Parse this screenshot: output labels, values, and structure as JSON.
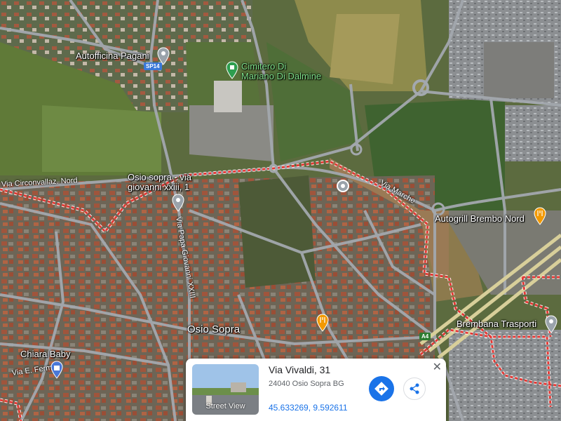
{
  "map": {
    "labels": {
      "autofficina": "Autofficina Pagani",
      "cimitero_line1": "Cimitero Di",
      "cimitero_line2": "Mariano Di Dalmine",
      "osio_line1": "Osio sopra - via",
      "osio_line2": "giovanni xxiii, 1",
      "autogrill": "Autogrill Brembo Nord",
      "osio_sopra": "Osio Sopra",
      "brembana": "Brembana Trasporti",
      "chiara": "Chiara Baby"
    },
    "roads": {
      "circonvallaz": "Via Circonvallaz. Nord",
      "marche": "Via Marche",
      "papa_giovanni": "Via Papa Giovanni XXIII",
      "fermi": "Via E. Fermi"
    },
    "shields": {
      "sp14": "SP14",
      "a4": "A4"
    }
  },
  "card": {
    "title": "Via Vivaldi, 31",
    "subtitle": "24040 Osio Sopra BG",
    "coords": "45.633269, 9.592611",
    "street_view": "Street View",
    "close": "✕"
  },
  "colors": {
    "accent": "#1a73e8",
    "boundary": "#e53935"
  },
  "icons": [
    "location-pin-icon",
    "cemetery-pin-icon",
    "restaurant-pin-icon",
    "shopping-bag-pin-icon",
    "directions-icon",
    "share-icon",
    "close-icon"
  ]
}
